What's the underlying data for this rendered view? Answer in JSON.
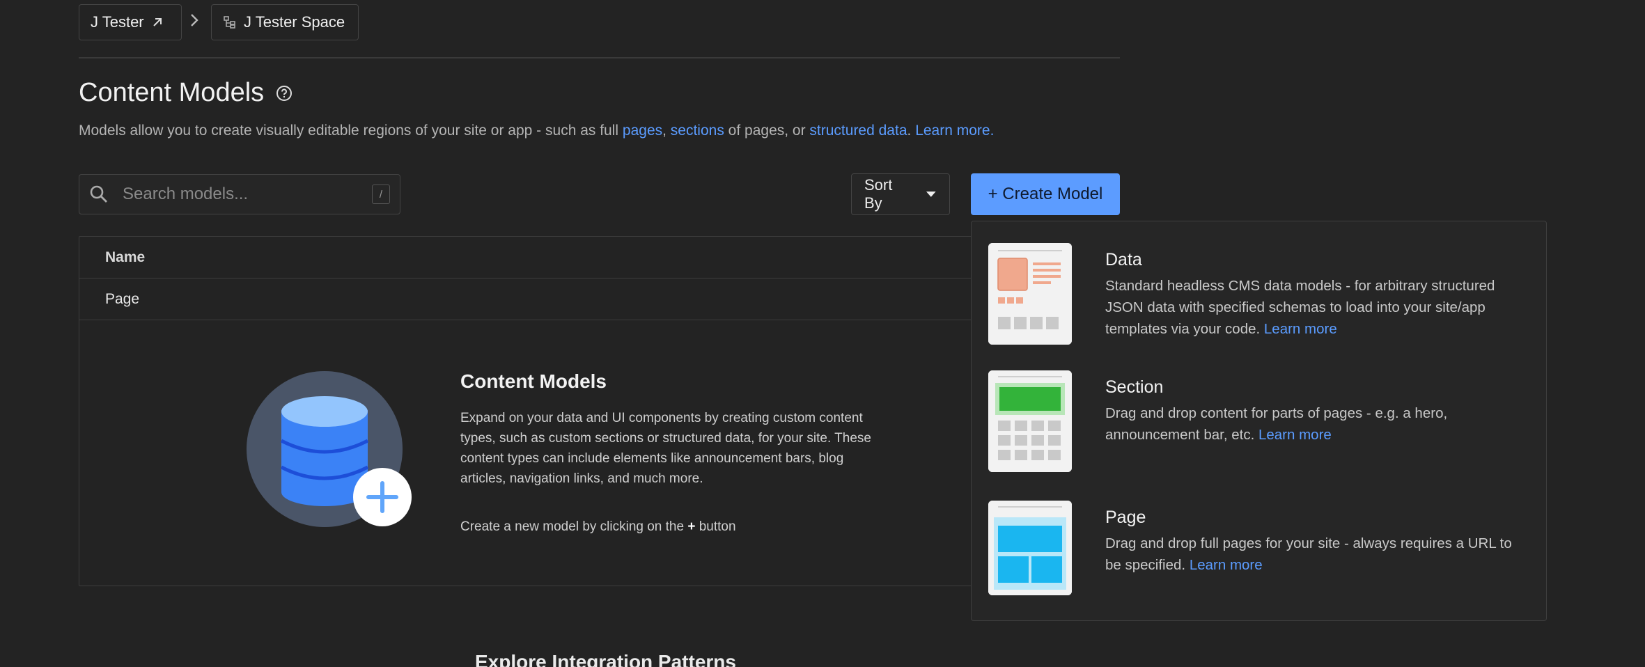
{
  "breadcrumb": {
    "org": "J Tester",
    "space": "J Tester Space"
  },
  "page": {
    "title": "Content Models",
    "subtitle_pre": "Models allow you to create visually editable regions of your site or app - such as full ",
    "link_pages": "pages",
    "sep1": ", ",
    "link_sections": "sections",
    "mid": " of pages, or ",
    "link_structured": "structured data",
    "sep2": ". ",
    "link_learn": "Learn more."
  },
  "toolbar": {
    "search_placeholder": "Search models...",
    "search_value": "",
    "search_shortcut": "/",
    "sort_label": "Sort By",
    "create_label": "+ Create Model"
  },
  "table": {
    "header_name": "Name",
    "rows": [
      {
        "name": "Page"
      }
    ]
  },
  "empty_state": {
    "title": "Content Models",
    "description": "Expand on your data and UI components by creating custom content types, such as custom sections or structured data, for your site. These content types can include elements like announcement bars, blog articles, navigation links, and much more.",
    "hint_pre": "Create a new model by clicking on the ",
    "hint_plus": "+",
    "hint_post": " button"
  },
  "explore_heading": "Explore Integration Patterns",
  "create_menu": {
    "options": [
      {
        "title": "Data",
        "description": "Standard headless CMS data models - for arbitrary structured JSON data with specified schemas to load into your site/app templates via your code. ",
        "link": "Learn more"
      },
      {
        "title": "Section",
        "description": "Drag and drop content for parts of pages - e.g. a hero, announcement bar, etc. ",
        "link": "Learn more"
      },
      {
        "title": "Page",
        "description": "Drag and drop full pages for your site - always requires a URL to be specified. ",
        "link": "Learn more"
      }
    ]
  },
  "colors": {
    "background": "#232323",
    "accent": "#5c9cff",
    "link": "#5b9cff",
    "data_thumb": "#f0a88d",
    "section_thumb": "#33b33a",
    "page_thumb": "#1ab6f0"
  }
}
